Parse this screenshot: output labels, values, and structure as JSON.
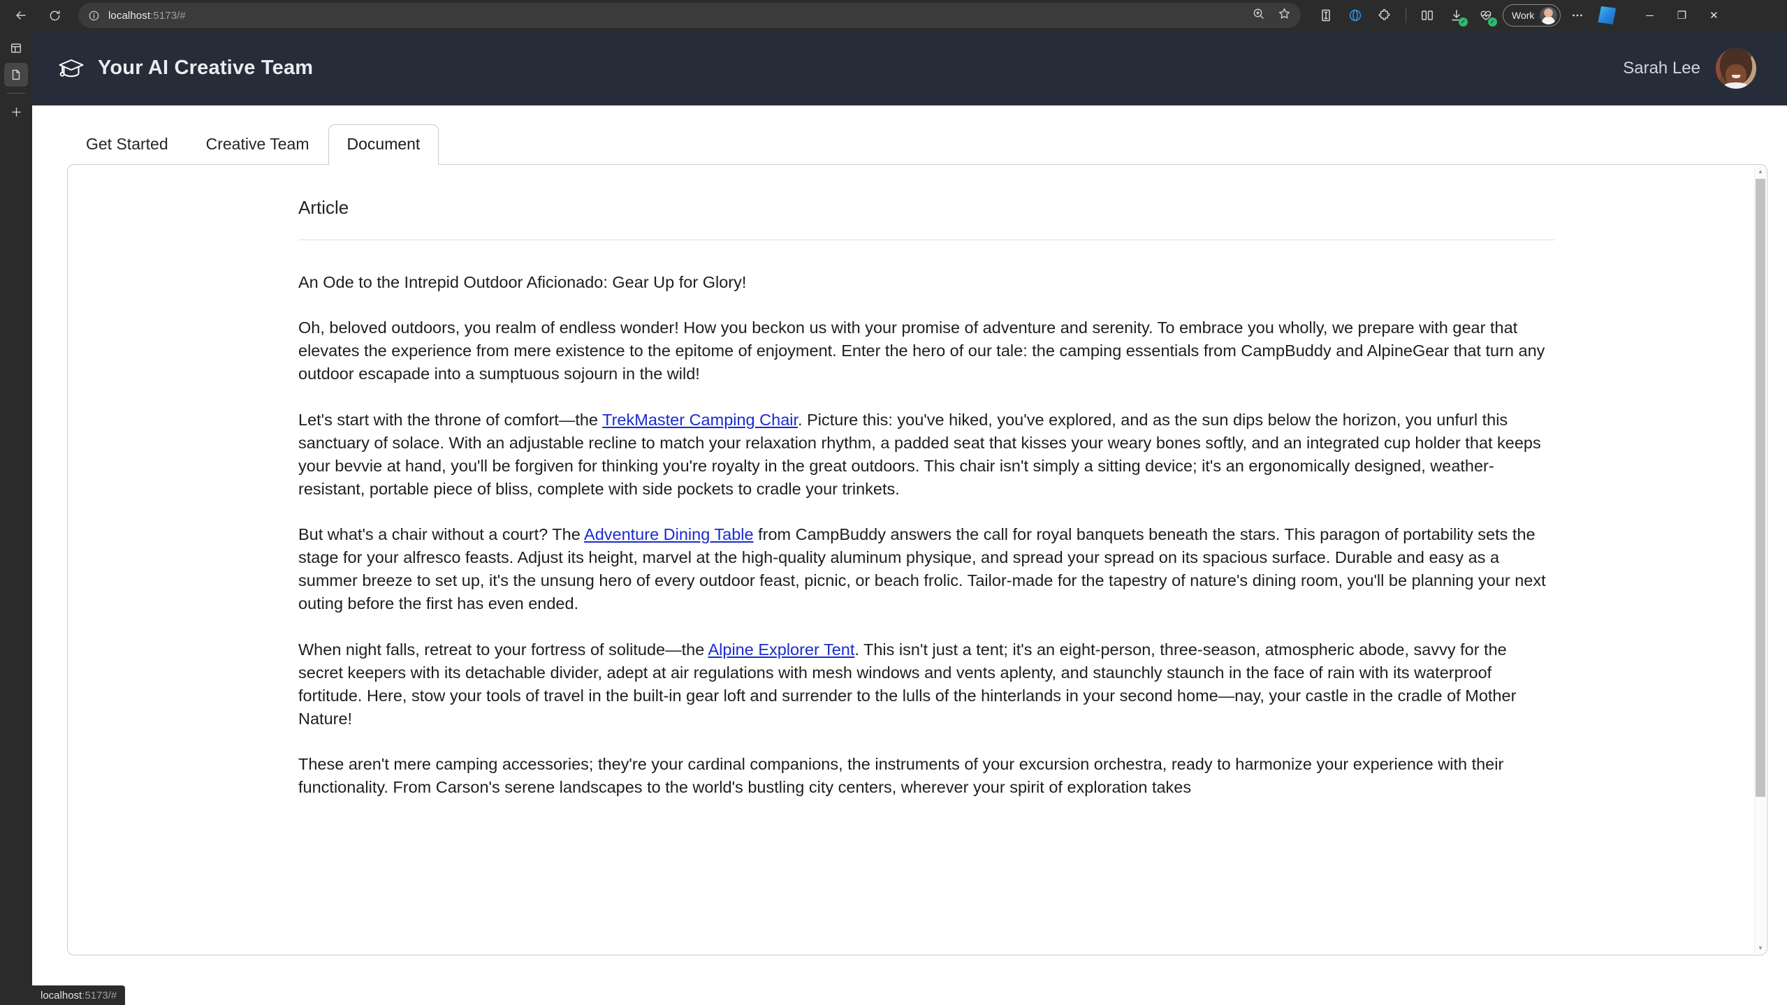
{
  "browser": {
    "url_host": "localhost",
    "url_path": ":5173/#",
    "back_icon": "back-arrow-icon",
    "reload_icon": "reload-icon",
    "info_icon": "info-circle-icon",
    "zoom_icon": "zoom-in-icon",
    "favorite_icon": "star-icon",
    "profile_label": "Work",
    "status_host": "localhost",
    "status_path": ":5173/#",
    "minimize_label": "─",
    "restore_label": "❐",
    "close_label": "✕"
  },
  "rail": {
    "split_icon": "split-screen-icon",
    "document_icon": "document-icon",
    "add_icon": "plus-icon"
  },
  "app": {
    "logo_icon": "graduation-cap-icon",
    "title": "Your AI Creative Team",
    "user_name": "Sarah Lee",
    "avatar_icon": "user-avatar"
  },
  "tabs": [
    {
      "label": "Get Started",
      "active": false
    },
    {
      "label": "Creative Team",
      "active": false
    },
    {
      "label": "Document",
      "active": true
    }
  ],
  "document": {
    "section_label": "Article",
    "title": "An Ode to the Intrepid Outdoor Aficionado: Gear Up for Glory!",
    "paragraphs": [
      {
        "segments": [
          {
            "text": "Oh, beloved outdoors, you realm of endless wonder! How you beckon us with your promise of adventure and serenity. To embrace you wholly, we prepare with gear that elevates the experience from mere existence to the epitome of enjoyment. Enter the hero of our tale: the camping essentials from CampBuddy and AlpineGear that turn any outdoor escapade into a sumptuous sojourn in the wild!",
            "link": false
          }
        ]
      },
      {
        "segments": [
          {
            "text": "Let's start with the throne of comfort—the ",
            "link": false
          },
          {
            "text": "TrekMaster Camping Chair",
            "link": true
          },
          {
            "text": ". Picture this: you've hiked, you've explored, and as the sun dips below the horizon, you unfurl this sanctuary of solace. With an adjustable recline to match your relaxation rhythm, a padded seat that kisses your weary bones softly, and an integrated cup holder that keeps your bevvie at hand, you'll be forgiven for thinking you're royalty in the great outdoors. This chair isn't simply a sitting device; it's an ergonomically designed, weather-resistant, portable piece of bliss, complete with side pockets to cradle your trinkets.",
            "link": false
          }
        ]
      },
      {
        "segments": [
          {
            "text": "But what's a chair without a court? The ",
            "link": false
          },
          {
            "text": "Adventure Dining Table",
            "link": true
          },
          {
            "text": " from CampBuddy answers the call for royal banquets beneath the stars. This paragon of portability sets the stage for your alfresco feasts. Adjust its height, marvel at the high-quality aluminum physique, and spread your spread on its spacious surface. Durable and easy as a summer breeze to set up, it's the unsung hero of every outdoor feast, picnic, or beach frolic. Tailor-made for the tapestry of nature's dining room, you'll be planning your next outing before the first has even ended.",
            "link": false
          }
        ]
      },
      {
        "segments": [
          {
            "text": "When night falls, retreat to your fortress of solitude—the ",
            "link": false
          },
          {
            "text": "Alpine Explorer Tent",
            "link": true
          },
          {
            "text": ". This isn't just a tent; it's an eight-person, three-season, atmospheric abode, savvy for the secret keepers with its detachable divider, adept at air regulations with mesh windows and vents aplenty, and staunchly staunch in the face of rain with its waterproof fortitude. Here, stow your tools of travel in the built-in gear loft and surrender to the lulls of the hinterlands in your second home—nay, your castle in the cradle of Mother Nature!",
            "link": false
          }
        ]
      },
      {
        "segments": [
          {
            "text": "These aren't mere camping accessories; they're your cardinal companions, the instruments of your excursion orchestra, ready to harmonize your experience with their functionality. From Carson's serene landscapes to the world's bustling city centers, wherever your spirit of exploration takes",
            "link": false
          }
        ]
      }
    ]
  },
  "colors": {
    "header_bg": "#262d38",
    "link": "#1a2bcc",
    "chrome_bg": "#2b2b2b",
    "page_bg": "#ffffff",
    "border": "#c8cdd2"
  }
}
